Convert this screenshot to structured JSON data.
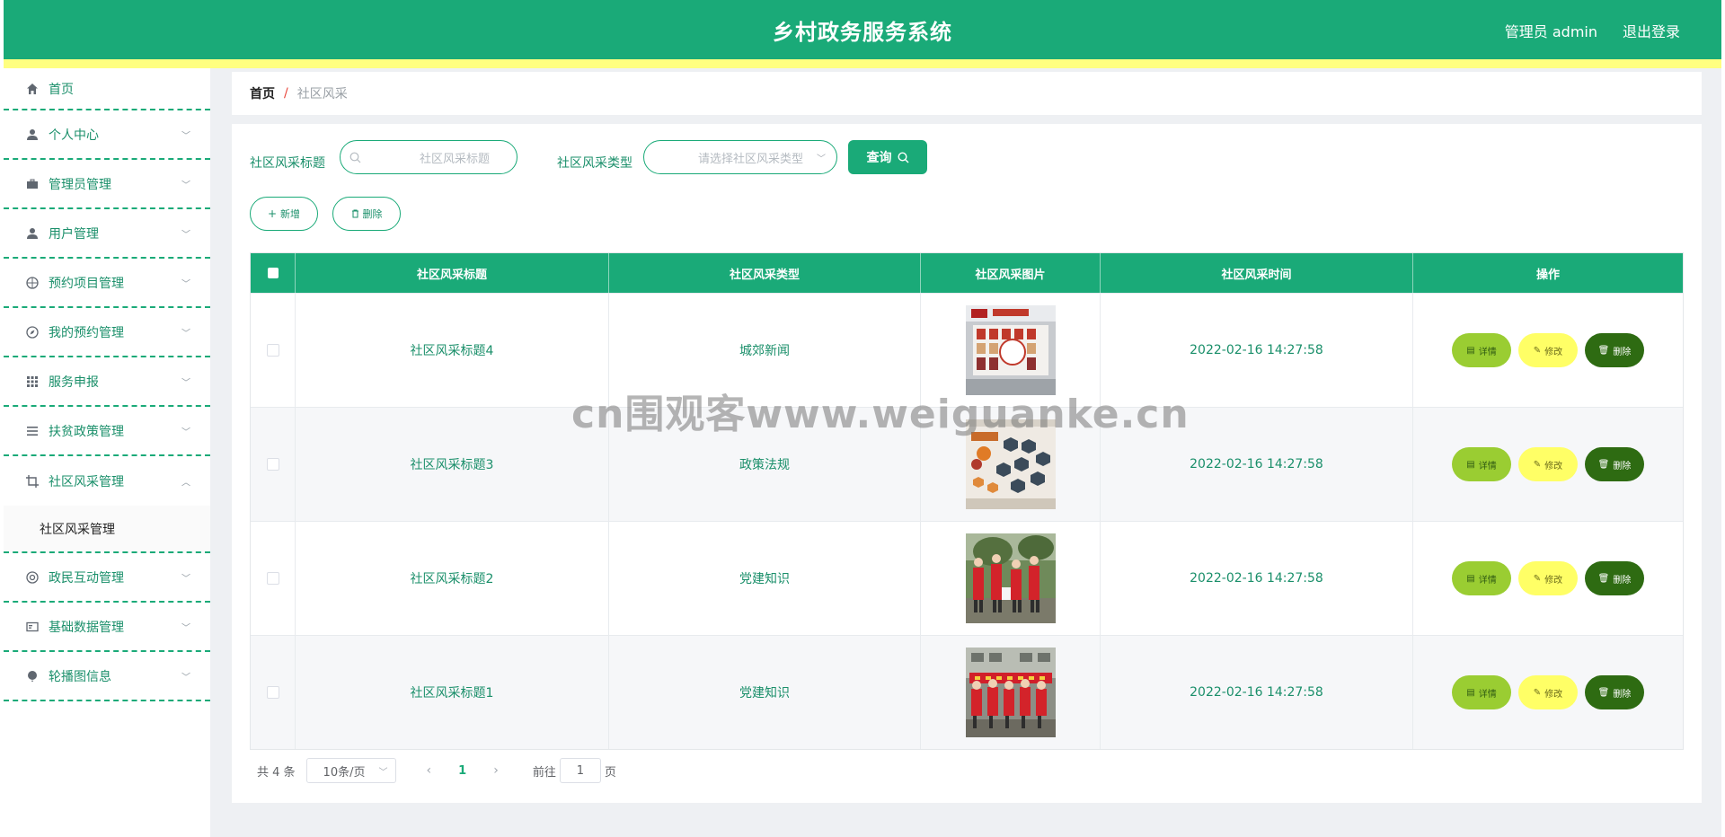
{
  "header": {
    "title": "乡村政务服务系统",
    "admin_label": "管理员 admin",
    "logout_label": "退出登录"
  },
  "sidebar": {
    "items": [
      {
        "label": "首页",
        "icon": "home-icon"
      },
      {
        "label": "个人中心",
        "icon": "user-icon"
      },
      {
        "label": "管理员管理",
        "icon": "briefcase-icon"
      },
      {
        "label": "用户管理",
        "icon": "user-icon"
      },
      {
        "label": "预约项目管理",
        "icon": "basketball-icon"
      },
      {
        "label": "我的预约管理",
        "icon": "compass-icon"
      },
      {
        "label": "服务申报",
        "icon": "grid-icon"
      },
      {
        "label": "扶贫政策管理",
        "icon": "list-icon"
      },
      {
        "label": "社区风采管理",
        "icon": "crop-icon"
      },
      {
        "label": "政民互动管理",
        "icon": "lifebuoy-icon"
      },
      {
        "label": "基础数据管理",
        "icon": "card-icon"
      },
      {
        "label": "轮播图信息",
        "icon": "balloon-icon"
      }
    ],
    "submenu_label": "社区风采管理"
  },
  "breadcrumb": {
    "home": "首页",
    "separator": "/",
    "current": "社区风采"
  },
  "search": {
    "title_label": "社区风采标题",
    "title_placeholder": "社区风采标题",
    "type_label": "社区风采类型",
    "type_placeholder": "请选择社区风采类型",
    "query_label": "查询"
  },
  "actions": {
    "add_label": "新增",
    "delete_label": "删除"
  },
  "table": {
    "headers": [
      "社区风采标题",
      "社区风采类型",
      "社区风采图片",
      "社区风采时间",
      "操作"
    ],
    "rows": [
      {
        "title": "社区风采标题4",
        "type": "城郊新闻",
        "time": "2022-02-16 14:27:58"
      },
      {
        "title": "社区风采标题3",
        "type": "政策法规",
        "time": "2022-02-16 14:27:58"
      },
      {
        "title": "社区风采标题2",
        "type": "党建知识",
        "time": "2022-02-16 14:27:58"
      },
      {
        "title": "社区风采标题1",
        "type": "党建知识",
        "time": "2022-02-16 14:27:58"
      }
    ],
    "row_actions": {
      "detail": "详情",
      "edit": "修改",
      "delete": "删除"
    }
  },
  "pagination": {
    "total_text": "共 4 条",
    "page_size": "10条/页",
    "current_page": "1",
    "goto_prefix": "前往",
    "goto_value": "1",
    "goto_suffix": "页"
  },
  "watermark": "cn围观客www.weiguanke.cn",
  "colors": {
    "primary": "#1aaa78",
    "stripe": "#ffff80",
    "detail": "#9acd32",
    "edit": "#ffff66",
    "delete": "#2e6b12"
  }
}
